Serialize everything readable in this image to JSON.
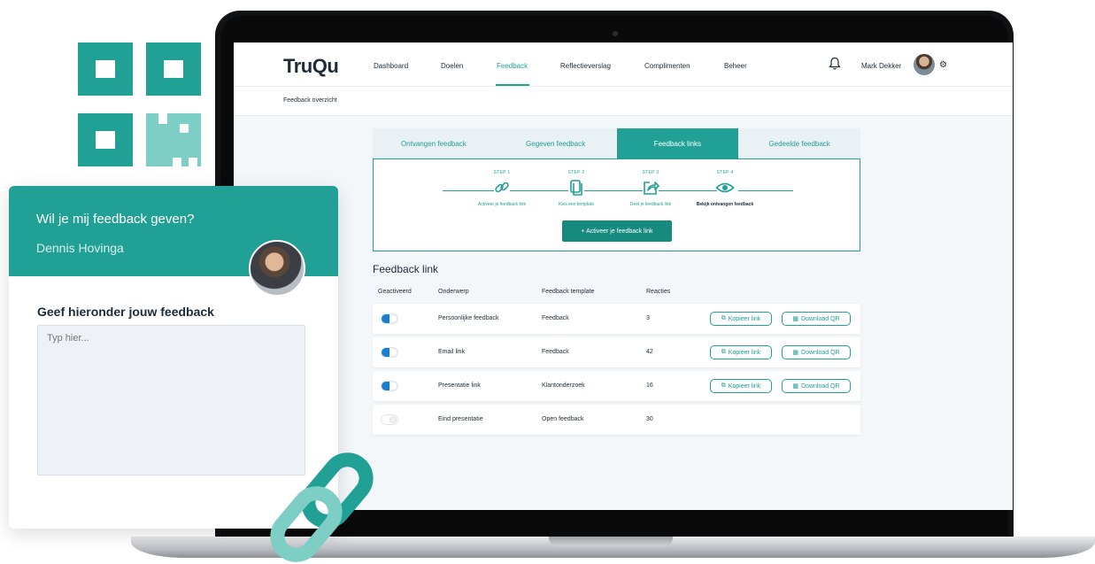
{
  "colors": {
    "accent": "#21a095",
    "accent_dark": "#178a80",
    "toggle_on": "#1a7fd1",
    "text": "#1c2b39"
  },
  "app": {
    "logo": "TruQu",
    "nav": [
      "Dashboard",
      "Doelen",
      "Feedback",
      "Reflectieverslag",
      "Complimenten",
      "Beheer"
    ],
    "nav_active": "Feedback",
    "user_name": "Mark Dekker",
    "breadcrumb": "Feedback overzicht"
  },
  "tabs": [
    "Ontvangen feedback",
    "Gegeven feedback",
    "Feedback links",
    "Gedeelde feedback"
  ],
  "tab_active": "Feedback links",
  "steps": [
    {
      "num": "STEP 1",
      "caption": "Activeer je feedback link",
      "icon": "link-icon"
    },
    {
      "num": "STEP 2",
      "caption": "Kies een template",
      "icon": "copy-icon"
    },
    {
      "num": "STEP 3",
      "caption": "Deel je feedback link",
      "icon": "share-icon"
    },
    {
      "num": "STEP 4",
      "caption": "Bekijk ontvangen feedback",
      "icon": "eye-icon"
    }
  ],
  "activate_button": "+ Activeer je feedback link",
  "section_title": "Feedback link",
  "columns": {
    "active": "Geactiveerd",
    "subject": "Onderwerp",
    "template": "Feedback template",
    "reactions": "Reacties"
  },
  "rows": [
    {
      "active": true,
      "subject": "Persoonlijke feedback",
      "template": "Feedback",
      "reactions": "3",
      "copy": "Kopieer link",
      "qr": "Download QR"
    },
    {
      "active": true,
      "subject": "Email link",
      "template": "Feedback",
      "reactions": "42",
      "copy": "Kopieer link",
      "qr": "Download QR"
    },
    {
      "active": true,
      "subject": "Presentatie link",
      "template": "Klantonderzoek",
      "reactions": "16",
      "copy": "Kopieer link",
      "qr": "Download QR"
    },
    {
      "active": false,
      "subject": "Eind presentatie",
      "template": "Open feedback",
      "reactions": "30",
      "copy": "",
      "qr": ""
    }
  ],
  "card": {
    "question": "Wil je mij feedback geven?",
    "name": "Dennis Hovinga",
    "label": "Geef hieronder jouw feedback",
    "placeholder": "Typ hier..."
  }
}
